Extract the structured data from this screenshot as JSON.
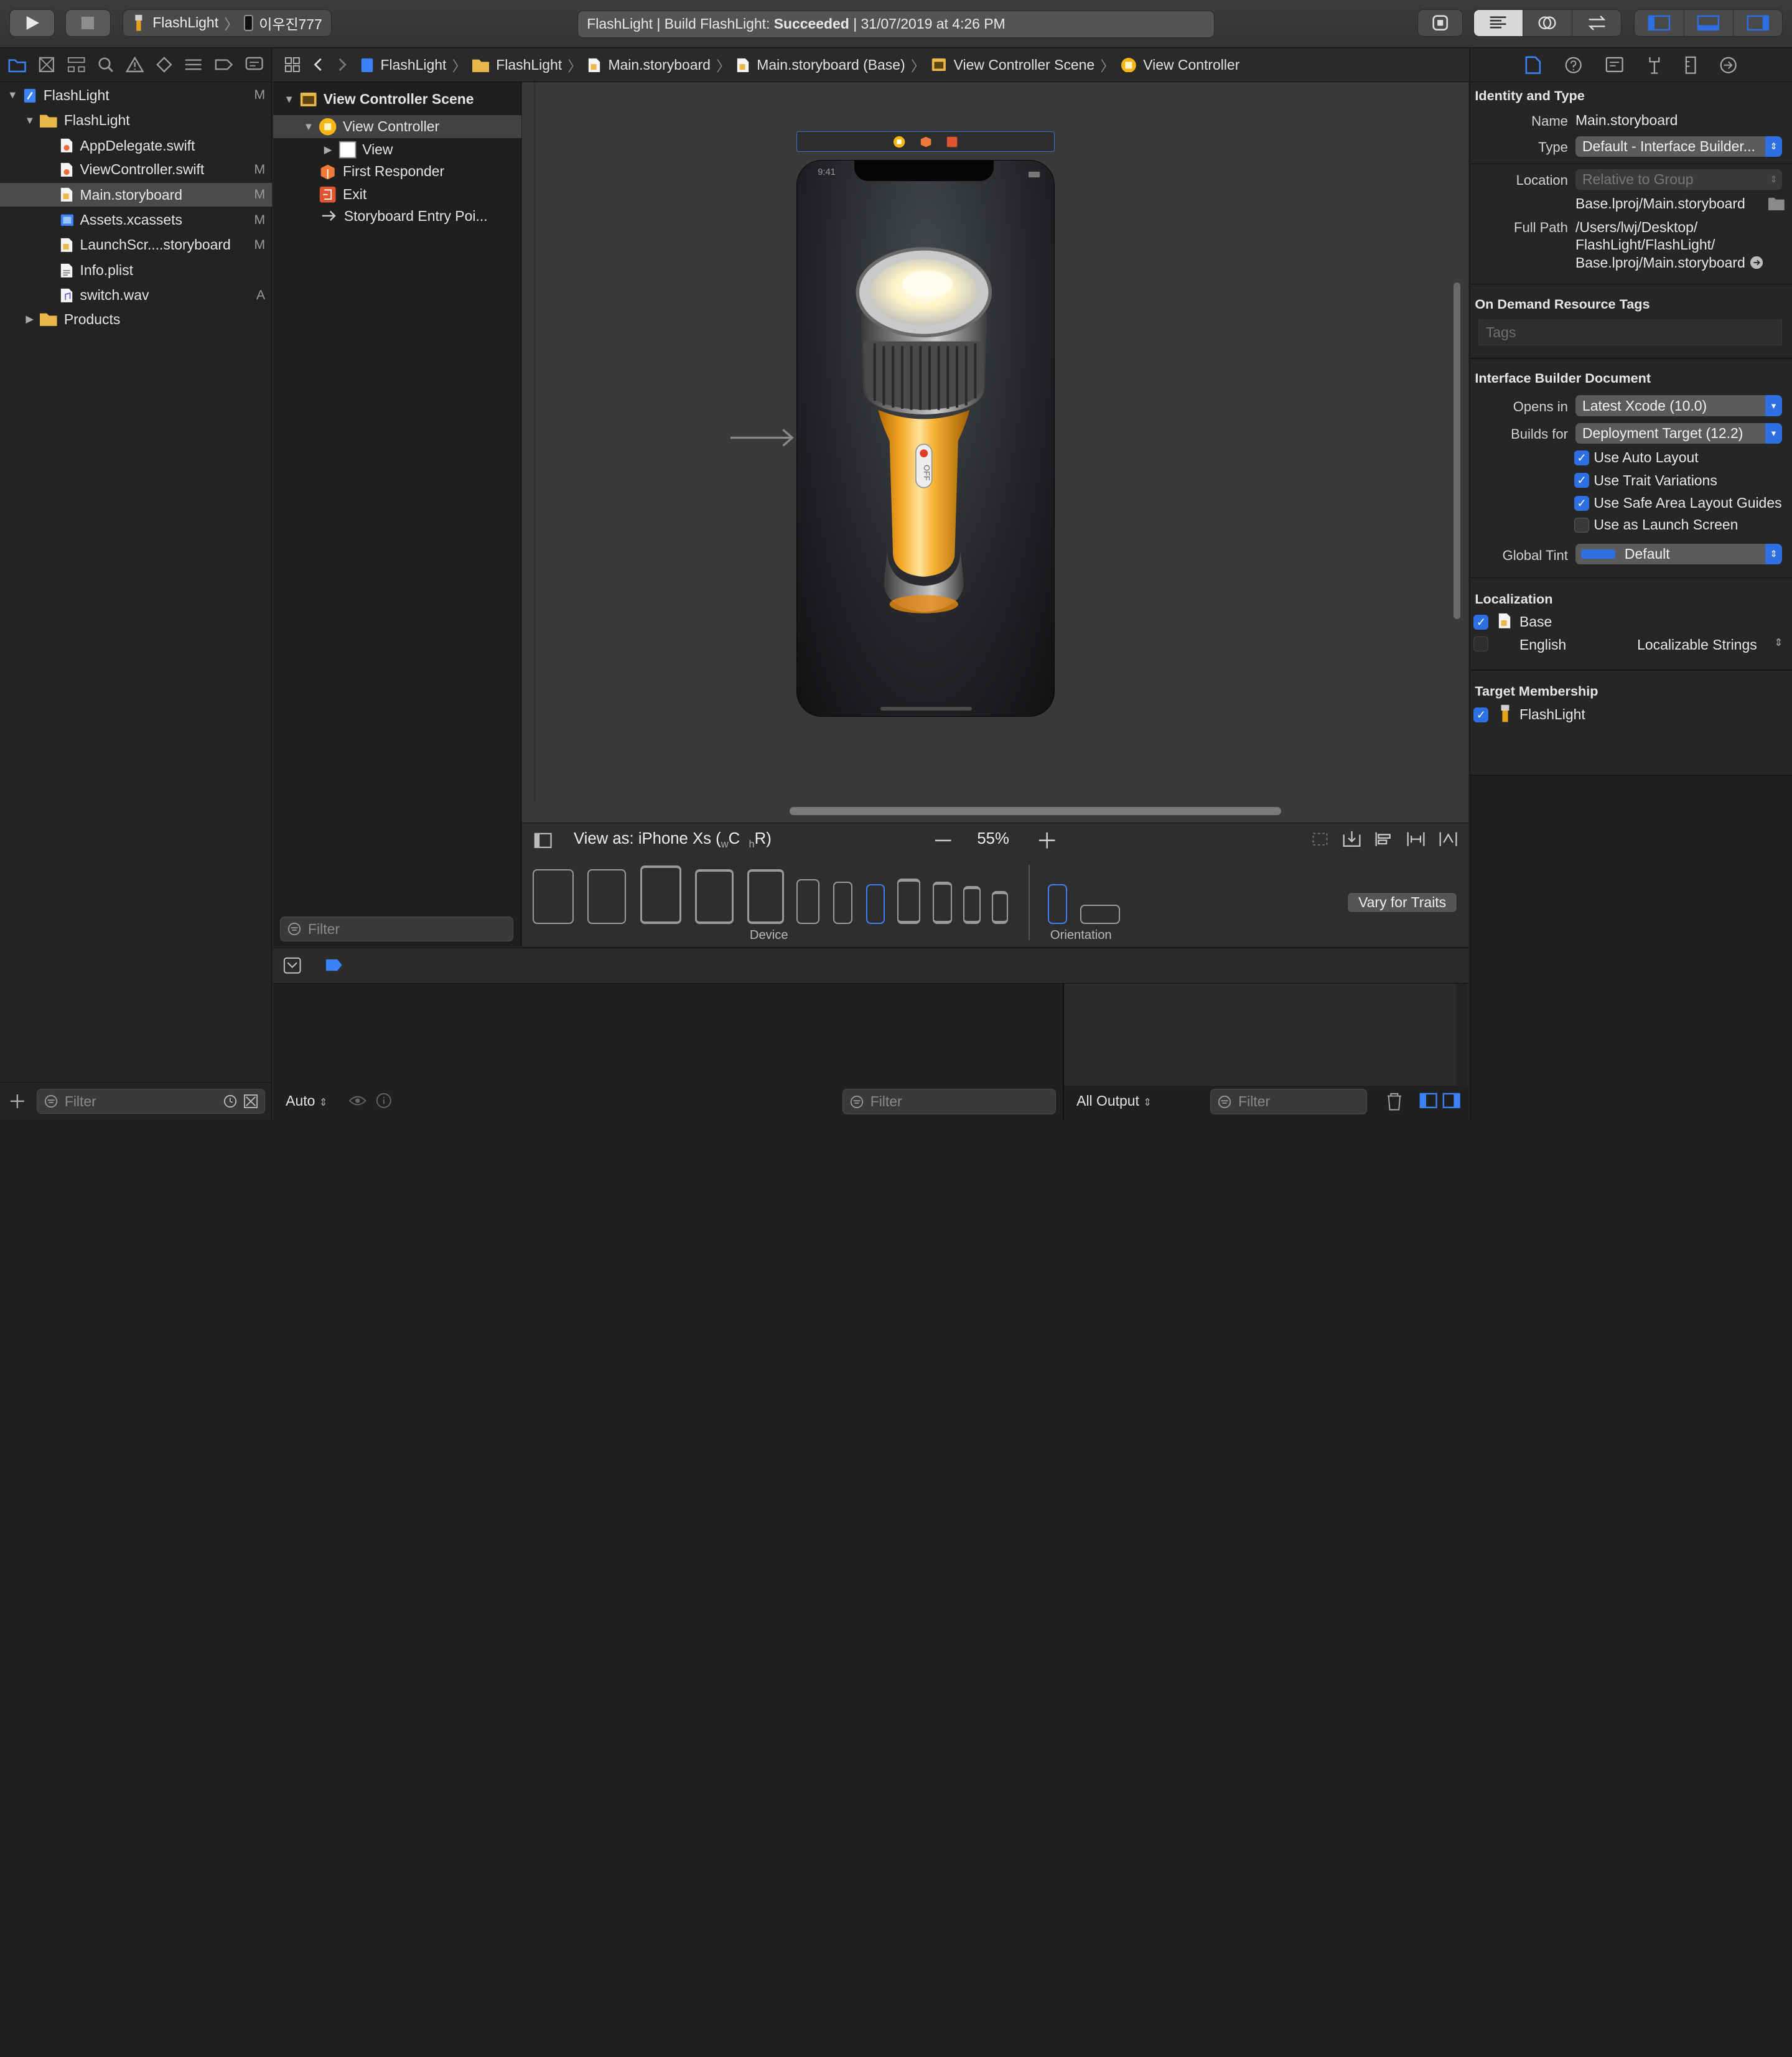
{
  "toolbar": {
    "scheme_name": "FlashLight",
    "device_name": "이우진777",
    "status_prefix": "FlashLight | Build FlashLight: ",
    "status_result": "Succeeded",
    "status_suffix": " | 31/07/2019 at 4:26 PM"
  },
  "navigator": {
    "items": [
      {
        "name": "FlashLight",
        "badge": "M"
      },
      {
        "name": "FlashLight",
        "badge": ""
      },
      {
        "name": "AppDelegate.swift",
        "badge": ""
      },
      {
        "name": "ViewController.swift",
        "badge": "M"
      },
      {
        "name": "Main.storyboard",
        "badge": "M"
      },
      {
        "name": "Assets.xcassets",
        "badge": "M"
      },
      {
        "name": "LaunchScr....storyboard",
        "badge": "M"
      },
      {
        "name": "Info.plist",
        "badge": ""
      },
      {
        "name": "switch.wav",
        "badge": "A"
      },
      {
        "name": "Products",
        "badge": ""
      }
    ],
    "filter_placeholder": "Filter"
  },
  "jumpbar": {
    "crumbs": [
      "FlashLight",
      "FlashLight",
      "Main.storyboard",
      "Main.storyboard (Base)",
      "View Controller Scene",
      "View Controller"
    ]
  },
  "outline": {
    "scene": "View Controller Scene",
    "items": [
      "View Controller",
      "View",
      "First Responder",
      "Exit",
      "Storyboard Entry Poi..."
    ],
    "filter_placeholder": "Filter"
  },
  "canvas": {
    "phone_time": "9:41",
    "switch_label": "OFF"
  },
  "device_bar": {
    "view_as_prefix": "View as: iPhone Xs (",
    "w_sub": "w",
    "w_val": "C",
    "h_sub": "h",
    "h_val": "R)",
    "zoom": "55%",
    "device_label": "Device",
    "orientation_label": "Orientation",
    "vary_button": "Vary for Traits"
  },
  "debug": {
    "auto_label": "Auto",
    "filter_placeholder": "Filter",
    "output_label": "All Output",
    "filter2_placeholder": "Filter"
  },
  "inspector": {
    "identity_header": "Identity and Type",
    "name_label": "Name",
    "name_value": "Main.storyboard",
    "type_label": "Type",
    "type_value": "Default - Interface Builder...",
    "location_label": "Location",
    "location_value": "Relative to Group",
    "location_file": "Base.lproj/Main.storyboard",
    "fullpath_label": "Full Path",
    "fullpath_lines": [
      "/Users/lwj/Desktop/",
      "FlashLight/FlashLight/",
      "Base.lproj/Main.storyboard"
    ],
    "tags_header": "On Demand Resource Tags",
    "tags_placeholder": "Tags",
    "ibdoc_header": "Interface Builder Document",
    "opens_label": "Opens in",
    "opens_value": "Latest Xcode (10.0)",
    "builds_label": "Builds for",
    "builds_value": "Deployment Target (12.2)",
    "checks": [
      {
        "label": "Use Auto Layout",
        "checked": true
      },
      {
        "label": "Use Trait Variations",
        "checked": true
      },
      {
        "label": "Use Safe Area Layout Guides",
        "checked": true
      },
      {
        "label": "Use as Launch Screen",
        "checked": false
      }
    ],
    "tint_label": "Global Tint",
    "tint_value": "Default",
    "tint_color": "#2f6fe4",
    "localization_header": "Localization",
    "loc_base": "Base",
    "loc_english": "English",
    "loc_english_mode": "Localizable Strings",
    "target_header": "Target Membership",
    "target_name": "FlashLight"
  },
  "colors": {
    "accent": "#2f6fe4",
    "background": "#262626"
  }
}
